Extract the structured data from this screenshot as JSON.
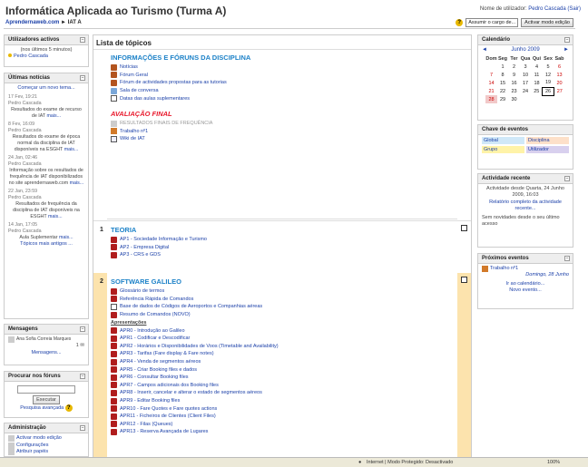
{
  "site_title": "Informática Aplicada ao Turismo (Turma A)",
  "login": {
    "prefix": "Nome de utilizador:",
    "user": "Pedro Cascada",
    "action": "(Sair)"
  },
  "breadcrumb": {
    "home": "Aprendernaweb.com",
    "sep": "►",
    "course": "IAT A"
  },
  "roles": {
    "select_value": "Assumir o cargo de...",
    "edit_button": "Activar modo edição"
  },
  "left": {
    "online": {
      "title": "Utilizadores activos",
      "subtitle": "(nos últimos 5 minutos)",
      "user": "Pedro Cascada"
    },
    "news": {
      "title": "Últimas notícias",
      "add_link": "Começar um novo tema...",
      "items": [
        {
          "date": "17 Fev, 19:21",
          "author": "Pedro Cascada",
          "text": "Resultados do exame de recurso de IAT",
          "more": "mais..."
        },
        {
          "date": "8 Fev, 16:09",
          "author": "Pedro Cascada",
          "text": "Resultados do exame de época normal da disciplina de IAT disponíveis na ESGHT",
          "more": "mais..."
        },
        {
          "date": "24 Jan, 02:46",
          "author": "Pedro Cascada",
          "text": "Informação sobre os resultados de frequência de IAT disponibilizados no site aprendernaweb.com",
          "more": "mais..."
        },
        {
          "date": "22 Jan, 23:59",
          "author": "Pedro Cascada",
          "text": "Resultados de frequência da disciplina de IAT disponíveis na ESGHT",
          "more": "mais..."
        },
        {
          "date": "14 Jan, 17:05",
          "author": "Pedro Cascada",
          "text": "Aula Suplementar",
          "more": "mais..."
        }
      ],
      "older": "Tópicos mais antigos ..."
    },
    "messages": {
      "title": "Mensagens",
      "from": "Ana Sofia Correia Marques",
      "count": "1",
      "link": "Mensagens..."
    },
    "search": {
      "title": "Procurar nos fóruns",
      "button": "Executar",
      "advanced": "Pesquisa avançada"
    },
    "admin": {
      "title": "Administração",
      "items": [
        "Activar modo edição",
        "Configurações",
        "Atribuir papéis"
      ]
    }
  },
  "main": {
    "title": "Lista de tópicos",
    "section0": {
      "heading": "INFORMAÇÕES E FÓRUNS DA DISCIPLINA",
      "items": [
        "Notícias",
        "Fórum Geral",
        "Fórum de actividades propostas para as tutorias",
        "Sala de conversa",
        "Datas das aulas suplementares"
      ],
      "red_heading": "AVALIAÇÃO FINAL",
      "items2": [
        "RESULTADOS FINAIS DE FREQUÊNCIA",
        "Trabalho nº1",
        "Wiki de IAT"
      ]
    },
    "section1": {
      "num": "1",
      "heading": "TEORIA",
      "items": [
        "AP1 - Sociedade Informação e Turismo",
        "AP2 - Empresa Digital",
        "AP3 - CRS e GDS"
      ]
    },
    "section2": {
      "num": "2",
      "heading": "SOFTWARE GALILEO",
      "items": [
        "Glossário de termos",
        "Referência Rápida de Comandos",
        "Base de dados de Códigos de Aeroportos e Companhias aéreas",
        "Resumo de Comandos (NOVO)"
      ],
      "sub": "Apresentações",
      "apr": [
        "APR0 - Introdução ao Galileo",
        "APR1 - Codificar e Descodificar",
        "APR2 - Horários e Disponibilidades de Voos (Timetable and Availability)",
        "APR3 - Tarifas (Fare display & Fare notes)",
        "APR4 - Venda de segmentos aéreos",
        "APR5 - Criar Booking files e dados",
        "APR6 - Consultar Booking files",
        "APR7 - Campos adicionais dos Booking files",
        "APR8 - Inserir, cancelar e alterar o estado de segmentos aéreos",
        "APR9 - Editar Booking files",
        "APR10 - Fare Quotes e Fare quotes actions",
        "APR11 - Ficheiros de Clientes (Client Files)",
        "APR12 - Filas (Queues)",
        "APR13 - Reserva Avançada de Lugares"
      ]
    }
  },
  "right": {
    "calendar": {
      "title": "Calendário",
      "month": "Junho 2009",
      "days": [
        "Dom",
        "Seg",
        "Ter",
        "Qua",
        "Qui",
        "Sex",
        "Sab"
      ],
      "weeks": [
        [
          "",
          "1",
          "2",
          "3",
          "4",
          "5",
          "6"
        ],
        [
          "7",
          "8",
          "9",
          "10",
          "11",
          "12",
          "13"
        ],
        [
          "14",
          "15",
          "16",
          "17",
          "18",
          "19",
          "20"
        ],
        [
          "21",
          "22",
          "23",
          "24",
          "25",
          "26",
          "27"
        ],
        [
          "28",
          "29",
          "30",
          "",
          "",
          "",
          ""
        ]
      ]
    },
    "events_key": {
      "title": "Chave de eventos",
      "items": [
        "Global",
        "Disciplina",
        "Grupo",
        "Utilizador"
      ]
    },
    "recent": {
      "title": "Actividade recente",
      "since": "Actividade desde Quarta, 24 Junho 2009, 16:03",
      "report": "Relatório completo da actividade recente...",
      "none": "Sem novidades desde o seu último acesso"
    },
    "upcoming": {
      "title": "Próximos eventos",
      "event": "Trabalho nº1",
      "when": "Domingo, 28 Junho",
      "calendar_link": "Ir ao calendário...",
      "new_event": "Novo evento..."
    }
  },
  "statusbar": {
    "zone": "Internet | Modo Protegido: Desactivado",
    "zoom": "100%"
  }
}
